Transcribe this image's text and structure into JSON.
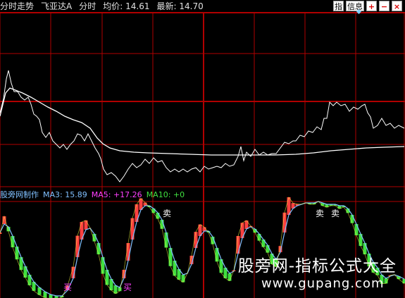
{
  "header": {
    "mode": "分时走势",
    "stock_name": "飞亚达A",
    "tab_label": "分时",
    "avg_label": "均价:",
    "avg_value": "14.61",
    "latest_label": "最新:",
    "latest_value": "14.70"
  },
  "toolbar": {
    "zhi_label": "指",
    "info_label": "信息",
    "plus_label": "+",
    "minus_label": "−",
    "close_label": "×"
  },
  "indicator": {
    "name": "股旁网制作",
    "ma3_label": "MA3:",
    "ma3_value": "15.89",
    "ma5_label": "MA5:",
    "ma5_value": "+17.26",
    "ma10_label": "MA10:",
    "ma10_value": "+0"
  },
  "markers": {
    "sell_label": "卖",
    "buy_label": "买"
  },
  "watermark": {
    "title": "股旁网-指标公式大全",
    "url": "www.gupang.com"
  },
  "colors": {
    "background": "#000000",
    "grid_red": "#b00000",
    "price_line": "#ffffff",
    "avg_line": "#ffffff",
    "kdj_up": "#ff4040",
    "kdj_down": "#40e040",
    "ma3": "#80c0ff",
    "ma5": "#ff40ff",
    "ma10": "#ffff40",
    "indicator_text": "#ffffff"
  }
}
